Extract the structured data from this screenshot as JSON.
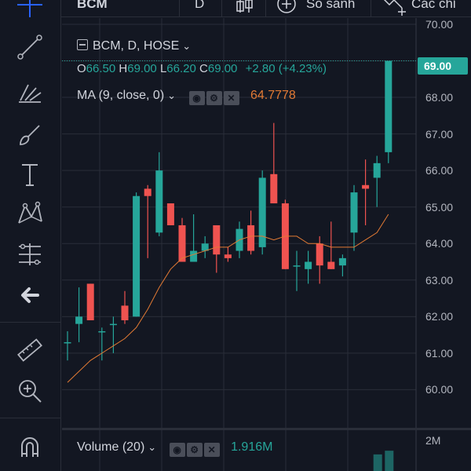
{
  "toolbar": {
    "symbol": "BCM",
    "interval": "D",
    "compare_label": "So sánh",
    "indicators_label": "Các chỉ"
  },
  "legend": {
    "title": "BCM, D, HOSE",
    "o_label": "O",
    "o_value": "66.50",
    "h_label": "H",
    "h_value": "69.00",
    "l_label": "L",
    "l_value": "66.20",
    "c_label": "C",
    "c_value": "69.00",
    "change": "+2.80 (+4.23%)",
    "ma_label": "MA (9, close, 0)",
    "ma_value": "64.7778"
  },
  "volume": {
    "label": "Volume (20)",
    "value": "1.916M",
    "axis_tick": "2M"
  },
  "price_axis": {
    "ticks": [
      "70.00",
      "69.00",
      "68.00",
      "67.00",
      "66.00",
      "65.00",
      "64.00",
      "63.00",
      "62.00",
      "61.00",
      "60.00"
    ],
    "last_price": "69.00"
  },
  "colors": {
    "background": "#131722",
    "up": "#26a69a",
    "down": "#ef5350",
    "ma": "#e27a34",
    "grid": "#2a2e39"
  },
  "tools": [
    "crosshair-icon",
    "trendline-icon",
    "fib-icon",
    "brush-icon",
    "text-icon",
    "pattern-icon",
    "measure-icon",
    "back-arrow-icon",
    "ruler-icon",
    "zoom-in-icon",
    "magnet-icon"
  ],
  "chart_data": {
    "type": "candlestick",
    "y_range": [
      59.3,
      70.3
    ],
    "candles": [
      {
        "o": 61.3,
        "h": 61.6,
        "l": 60.8,
        "c": 61.3
      },
      {
        "o": 61.8,
        "h": 62.8,
        "l": 61.3,
        "c": 62.0
      },
      {
        "o": 62.9,
        "h": 62.9,
        "l": 61.9,
        "c": 61.9
      },
      {
        "o": 61.6,
        "h": 61.7,
        "l": 60.8,
        "c": 61.6
      },
      {
        "o": 61.8,
        "h": 62.0,
        "l": 61.0,
        "c": 61.8
      },
      {
        "o": 62.3,
        "h": 62.7,
        "l": 61.8,
        "c": 61.9
      },
      {
        "o": 62.0,
        "h": 65.4,
        "l": 62.0,
        "c": 65.3
      },
      {
        "o": 65.5,
        "h": 65.6,
        "l": 63.6,
        "c": 65.3
      },
      {
        "o": 64.3,
        "h": 66.5,
        "l": 64.2,
        "c": 66.0
      },
      {
        "o": 65.1,
        "h": 65.1,
        "l": 64.5,
        "c": 64.5
      },
      {
        "o": 64.5,
        "h": 64.7,
        "l": 63.5,
        "c": 63.5
      },
      {
        "o": 63.5,
        "h": 64.8,
        "l": 63.5,
        "c": 63.8
      },
      {
        "o": 63.8,
        "h": 64.2,
        "l": 63.6,
        "c": 64.0
      },
      {
        "o": 64.5,
        "h": 64.5,
        "l": 63.2,
        "c": 63.7
      },
      {
        "o": 63.7,
        "h": 63.9,
        "l": 63.5,
        "c": 63.6
      },
      {
        "o": 63.8,
        "h": 64.6,
        "l": 63.6,
        "c": 64.4
      },
      {
        "o": 64.5,
        "h": 64.9,
        "l": 63.7,
        "c": 63.8
      },
      {
        "o": 63.9,
        "h": 66.0,
        "l": 63.7,
        "c": 65.8
      },
      {
        "o": 65.9,
        "h": 67.3,
        "l": 65.1,
        "c": 65.1
      },
      {
        "o": 65.1,
        "h": 65.2,
        "l": 63.3,
        "c": 63.3
      },
      {
        "o": 63.4,
        "h": 63.8,
        "l": 62.7,
        "c": 63.4
      },
      {
        "o": 63.3,
        "h": 63.8,
        "l": 62.9,
        "c": 63.5
      },
      {
        "o": 64.0,
        "h": 64.2,
        "l": 62.9,
        "c": 63.4
      },
      {
        "o": 63.5,
        "h": 64.6,
        "l": 63.3,
        "c": 63.3
      },
      {
        "o": 63.4,
        "h": 63.7,
        "l": 63.1,
        "c": 63.6
      },
      {
        "o": 64.3,
        "h": 65.6,
        "l": 63.8,
        "c": 65.4
      },
      {
        "o": 65.6,
        "h": 66.3,
        "l": 64.5,
        "c": 65.5
      },
      {
        "o": 65.8,
        "h": 66.4,
        "l": 65.0,
        "c": 66.2
      },
      {
        "o": 66.5,
        "h": 69.0,
        "l": 66.2,
        "c": 69.0
      }
    ],
    "ma": [
      60.2,
      60.5,
      60.8,
      61.0,
      61.2,
      61.4,
      61.7,
      62.2,
      62.8,
      63.3,
      63.6,
      63.7,
      63.8,
      63.9,
      63.9,
      64.1,
      64.2,
      64.2,
      64.1,
      64.2,
      64.2,
      64.0,
      64.0,
      63.9,
      63.9,
      63.9,
      64.1,
      64.3,
      64.8
    ],
    "volume": [
      0.9,
      1.1
    ]
  }
}
